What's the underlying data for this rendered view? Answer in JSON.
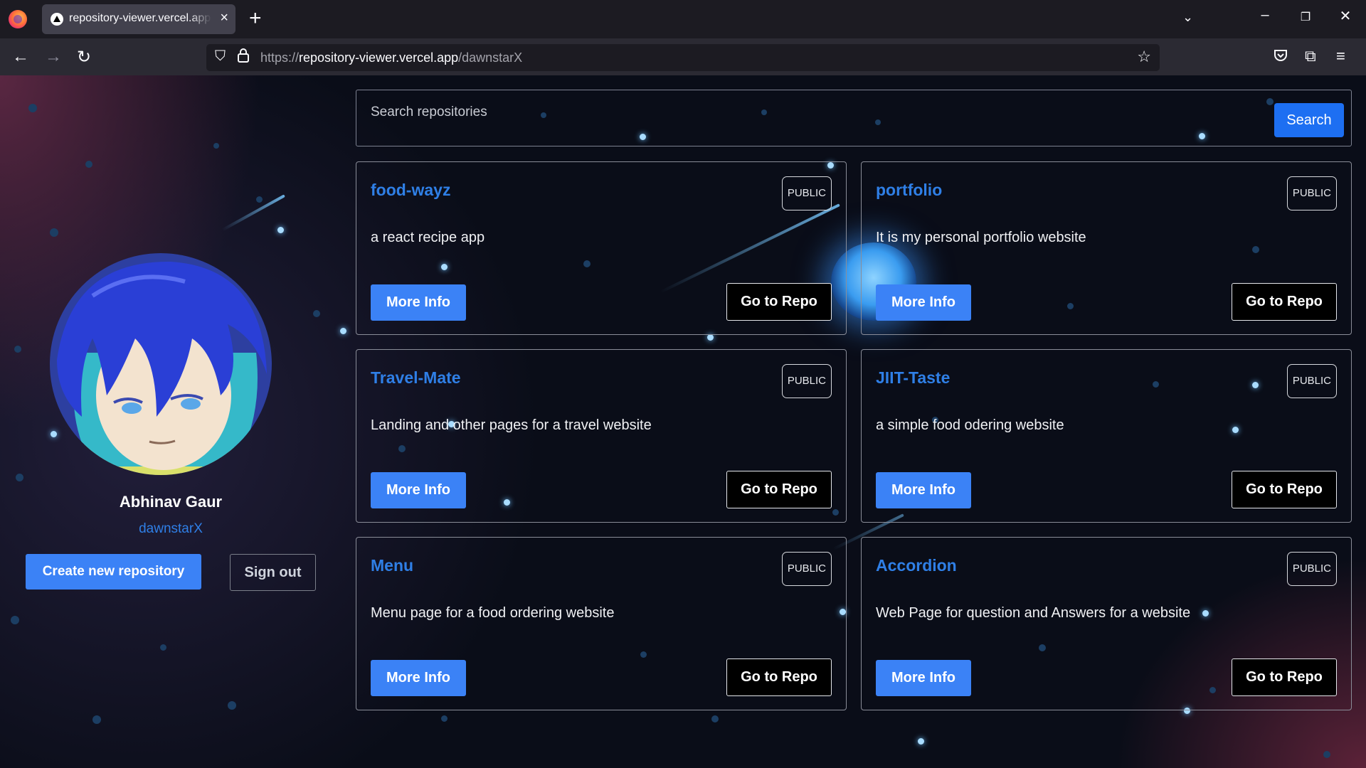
{
  "browser": {
    "tab_title": "repository-viewer.vercel.app/dawnstarX",
    "new_tab": "+",
    "url_protocol": "https://",
    "url_host": "repository-viewer.vercel.app",
    "url_path": "/dawnstarX"
  },
  "profile": {
    "name": "Abhinav Gaur",
    "login": "dawnstarX",
    "create_label": "Create new repository",
    "signout_label": "Sign out"
  },
  "search": {
    "placeholder": "Search repositories",
    "button_label": "Search"
  },
  "repos": [
    {
      "name": "food-wayz",
      "visibility": "PUBLIC",
      "description": "a react recipe app",
      "more_label": "More Info",
      "go_label": "Go to Repo"
    },
    {
      "name": "portfolio",
      "visibility": "PUBLIC",
      "description": "It is my personal portfolio website",
      "more_label": "More Info",
      "go_label": "Go to Repo"
    },
    {
      "name": "Travel-Mate",
      "visibility": "PUBLIC",
      "description": "Landing and other pages for a travel website",
      "more_label": "More Info",
      "go_label": "Go to Repo"
    },
    {
      "name": "JIIT-Taste",
      "visibility": "PUBLIC",
      "description": "a simple food odering website",
      "more_label": "More Info",
      "go_label": "Go to Repo"
    },
    {
      "name": "Menu",
      "visibility": "PUBLIC",
      "description": "Menu page for a food ordering website",
      "more_label": "More Info",
      "go_label": "Go to Repo"
    },
    {
      "name": "Accordion",
      "visibility": "PUBLIC",
      "description": "Web Page for question and Answers for a website",
      "more_label": "More Info",
      "go_label": "Go to Repo"
    }
  ],
  "colors": {
    "accent": "#3b82f6",
    "link": "#2f7fe6",
    "background": "#0a0d18"
  },
  "icons": [
    "firefox-icon",
    "close-icon",
    "list-all-tabs-icon",
    "minimize-icon",
    "restore-icon",
    "back-icon",
    "forward-icon",
    "reload-icon",
    "shield-icon",
    "lock-icon",
    "bookmark-star-icon",
    "pocket-icon",
    "extensions-icon",
    "menu-icon"
  ]
}
